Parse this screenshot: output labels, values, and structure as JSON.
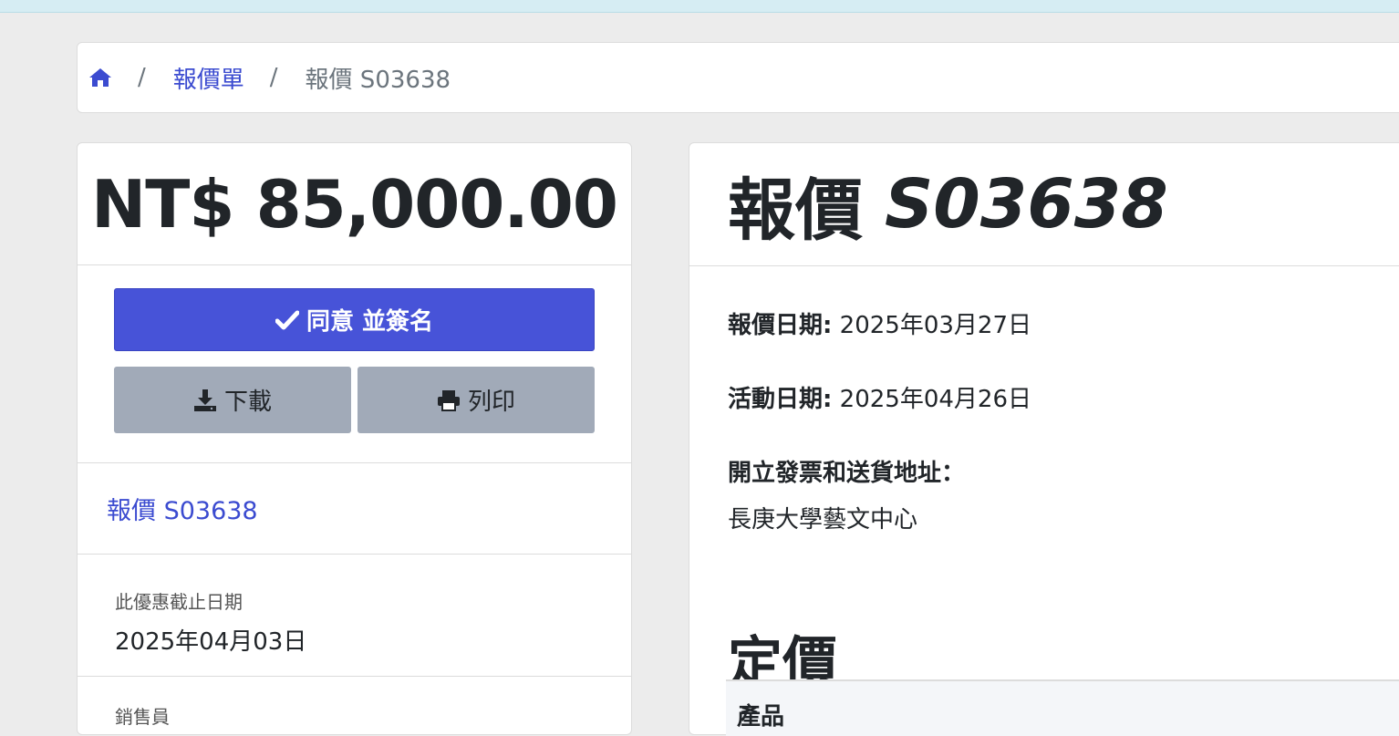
{
  "breadcrumb": {
    "home_icon": "home-icon",
    "separator": "/",
    "quotes_link": "報價單",
    "current": "報價 S03638"
  },
  "summary": {
    "total": "NT$ 85,000.00",
    "accept_sign_label": "同意 並簽名",
    "download_label": "下載",
    "print_label": "列印",
    "quote_link": "報價 S03638",
    "expiry_label": "此優惠截止日期",
    "expiry_value": "2025年04月03日",
    "salesperson_label": "銷售員"
  },
  "quote": {
    "title_prefix": "報價",
    "title_number": "S03638",
    "quote_date_label": "報價日期:",
    "quote_date_value": "2025年03月27日",
    "event_date_label": "活動日期:",
    "event_date_value": "2025年04月26日",
    "address_label": "開立發票和送貨地址：",
    "address_value": "長庚大學藝文中心",
    "pricing_title": "定價",
    "table_header_product": "產品"
  },
  "colors": {
    "primary": "#4753d8",
    "link": "#3b4bd0",
    "secondary_button": "#a1aab8"
  }
}
